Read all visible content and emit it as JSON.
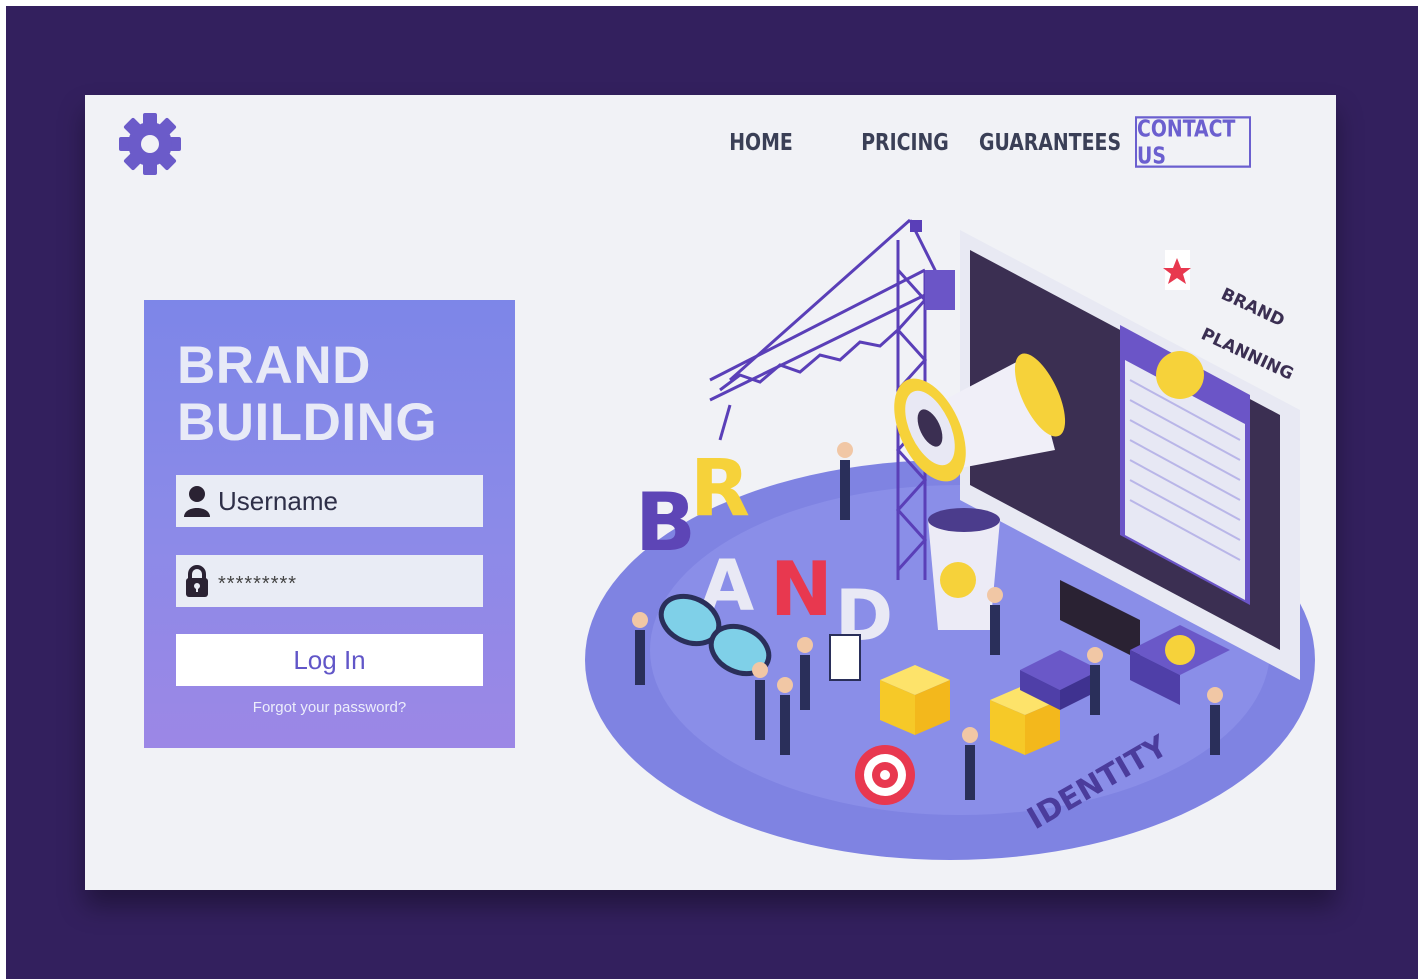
{
  "nav": {
    "home": "HOME",
    "pricing": "PRICING",
    "guarantees": "GUARANTEES",
    "contact": "CONTACT US"
  },
  "login": {
    "title_line1": "BRAND",
    "title_line2": "BUILDING",
    "username_value": "Username",
    "password_value": "*********",
    "login_button": "Log In",
    "forgot_link": "Forgot your password?"
  },
  "illustration": {
    "letters": [
      "B",
      "R",
      "A",
      "N",
      "D"
    ],
    "sign_line1": "BRAND",
    "sign_line2": "PLANNING",
    "floor_word": "IDENTITY"
  },
  "icons": {
    "logo": "gear-icon",
    "username": "user-icon",
    "password": "lock-icon"
  },
  "colors": {
    "frame": "#33205e",
    "page": "#f1f2f6",
    "accent": "#6b5fcf",
    "panel_top": "#7d86e8",
    "panel_bottom": "#9c87e6",
    "yellow": "#f6d23a",
    "red": "#e8384f"
  }
}
